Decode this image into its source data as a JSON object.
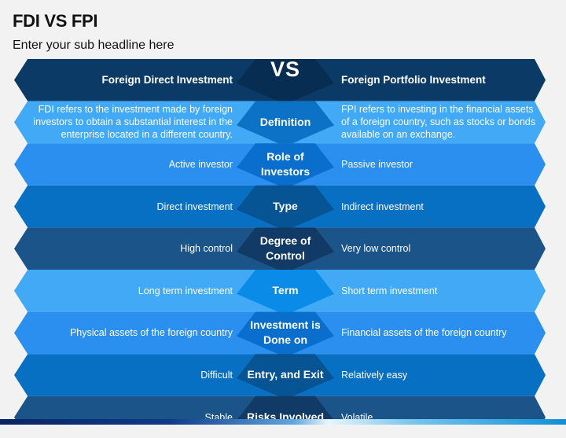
{
  "title": "FDI VS FPI",
  "subtitle": "Enter your sub headline here",
  "header": {
    "left": "Foreign Direct Investment",
    "center": "VS",
    "right": "Foreign Portfolio Investment",
    "color": "#0b3a66",
    "center_color": "#082d52"
  },
  "rows": [
    {
      "criterion": "Definition",
      "fdi": "FDI refers to the investment made by foreign investors to obtain a substantial interest in the enterprise located in a different country.",
      "fpi": "FPI refers to investing in the financial assets of a foreign country, such as stocks or bonds available on an exchange.",
      "color": "#41a9f5",
      "center_color": "#0b72c6"
    },
    {
      "criterion": "Role of Investors",
      "fdi": "Active investor",
      "fpi": "Passive investor",
      "color": "#2b8ff0",
      "center_color": "#0a6fcc"
    },
    {
      "criterion": "Type",
      "fdi": "Direct investment",
      "fpi": "Indirect investment",
      "color": "#0870c2",
      "center_color": "#075494"
    },
    {
      "criterion": "Degree of Control",
      "fdi": "High control",
      "fpi": "Very low control",
      "color": "#1b5489",
      "center_color": "#123a66"
    },
    {
      "criterion": "Term",
      "fdi": "Long term investment",
      "fpi": "Short term investment",
      "color": "#41a9f5",
      "center_color": "#0b8be8"
    },
    {
      "criterion": "Investment is Done on",
      "fdi": "Physical assets of the foreign country",
      "fpi": "Financial assets of the foreign country",
      "color": "#2b8ff0",
      "center_color": "#0a6fcc"
    },
    {
      "criterion": "Entry, and Exit",
      "fdi": "Difficult",
      "fpi": "Relatively easy",
      "color": "#0870c2",
      "center_color": "#075494"
    },
    {
      "criterion": "Risks Involved",
      "fdi": "Stable",
      "fpi": "Volatile",
      "color": "#1b5489",
      "center_color": "#123a66"
    }
  ]
}
